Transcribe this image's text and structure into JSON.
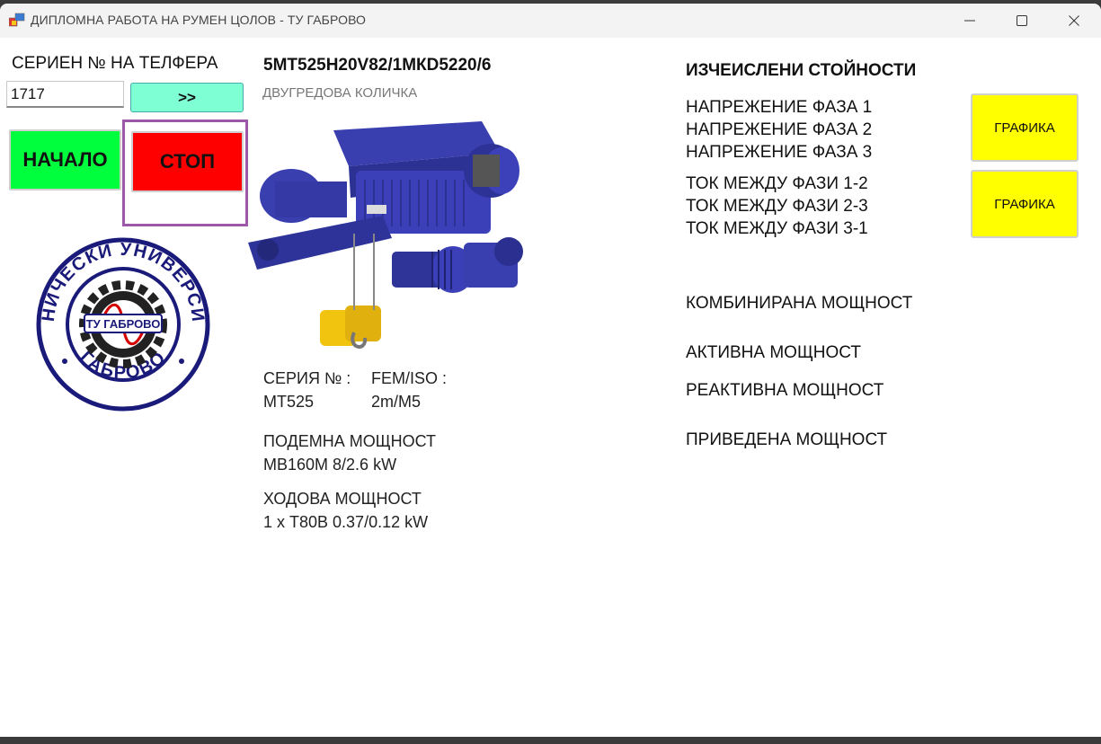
{
  "window": {
    "title": "ДИПЛОМНА РАБОТА НА РУМЕН ЦОЛОВ - ТУ ГАБРОВО"
  },
  "left_panel": {
    "serial_label": "СЕРИЕН № НА ТЕЛФЕРА",
    "serial_value": "1717",
    "go_button": ">>",
    "start_button": "НАЧАЛО",
    "stop_button": "СТОП",
    "logo": {
      "ring_text_top": "ТЕХНИЧЕСКИ УНИВЕРСИТЕТ",
      "ring_text_bottom": "ГАБРОВО",
      "center_text": "ТУ ГАБРОВО"
    }
  },
  "product": {
    "model": "5МТ525Н20V82/1МКD5220/6",
    "subtitle": "ДВУГРЕДОВА КОЛИЧКА",
    "series_label": "СЕРИЯ № :",
    "series_value": "МТ525",
    "fem_label": "FEM/ISO :",
    "fem_value": "2m/M5",
    "lift_label": "ПОДЕМНА МОЩНОСТ",
    "lift_value": "МВ160М 8/2.6 kW",
    "travel_label": "ХОДОВА МОЩНОСТ",
    "travel_value": "1 х Т80В 0.37/0.12 kW"
  },
  "calculated": {
    "header": "ИЗЧЕИСЛЕНИ СТОЙНОСТИ",
    "voltage": [
      "НАПРЕЖЕНИЕ ФАЗА 1",
      "НАПРЕЖЕНИЕ ФАЗА 2",
      "НАПРЕЖЕНИЕ ФАЗА 3"
    ],
    "current": [
      "ТОК МЕЖДУ ФАЗИ 1-2",
      "ТОК МЕЖДУ ФАЗИ 2-3",
      "ТОК МЕЖДУ ФАЗИ 3-1"
    ],
    "graph_button_1": "ГРАФИКА",
    "graph_button_2": "ГРАФИКА",
    "combined_power": "КОМБИНИРАНА МОЩНОСТ",
    "active_power": "АКТИВНА МОЩНОСТ",
    "reactive_power": "РЕАКТИВНА МОЩНОСТ",
    "reduced_power": "ПРИВЕДЕНА МОЩНОСТ"
  },
  "colors": {
    "start": "#00ff3c",
    "stop": "#ff0000",
    "go": "#7fffd4",
    "graph": "#ffff00",
    "highlight": "#9b59a8",
    "logo_navy": "#1a1a7a"
  }
}
